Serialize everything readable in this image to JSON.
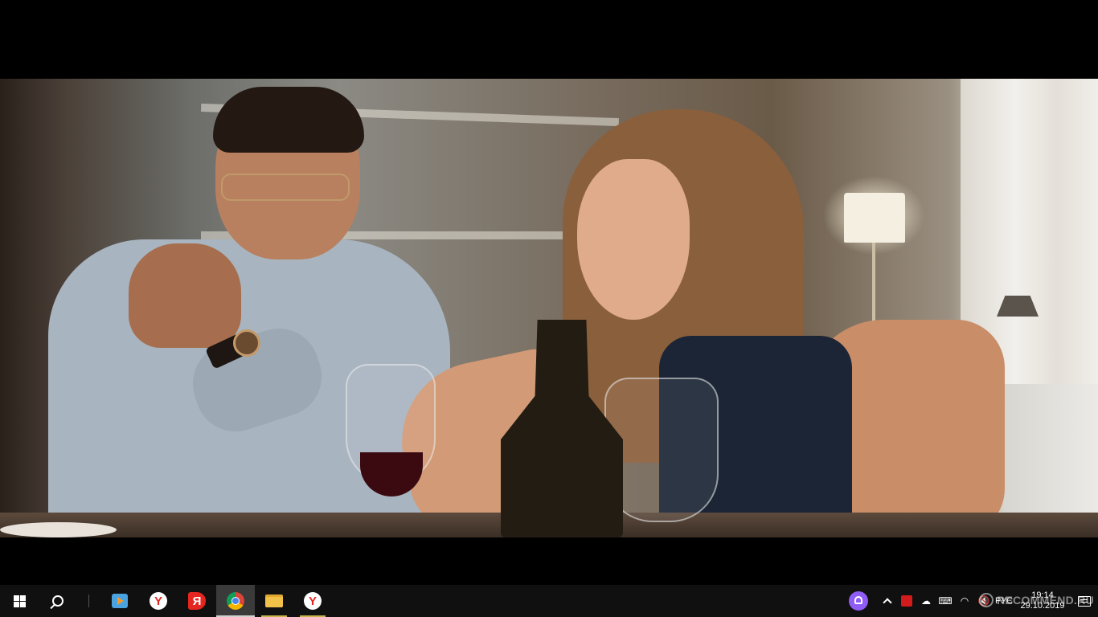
{
  "taskbar": {
    "apps": [
      {
        "name": "media-player",
        "glyph": ""
      },
      {
        "name": "yandex",
        "glyph": "Y"
      },
      {
        "name": "yandex-browser",
        "glyph": "Я"
      },
      {
        "name": "chrome",
        "glyph": ""
      },
      {
        "name": "file-explorer",
        "glyph": ""
      },
      {
        "name": "yandex-2",
        "glyph": "Y"
      }
    ],
    "tray": {
      "language": "РУС",
      "time": "19:14",
      "date": "29.10.2019"
    }
  },
  "watermark": {
    "text": "RECOMMEND.RU"
  },
  "colors": {
    "taskbar_bg": "#101010",
    "active_app_bg": "#3a3a3a",
    "running_indicator": "#c8b24a",
    "yandex_red": "#e52620",
    "alice_purple": "#8f5cf5"
  }
}
